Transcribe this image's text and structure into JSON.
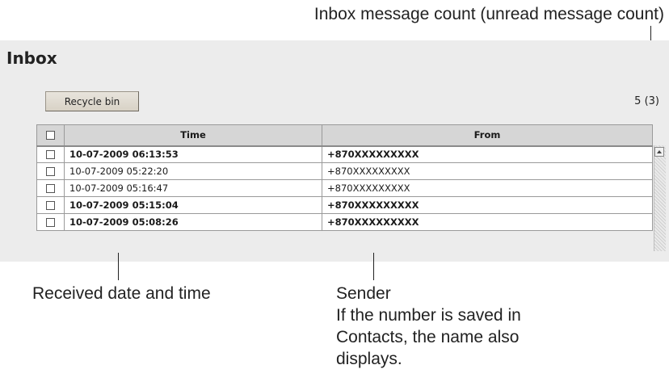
{
  "callouts": {
    "count_label": "Inbox message count (unread message count)",
    "received_label": "Received date and time",
    "sender_lines": [
      "Sender",
      "If the number is saved in",
      "Contacts, the name also",
      "displays."
    ]
  },
  "inbox": {
    "title": "Inbox",
    "recycle_bin_label": "Recycle bin",
    "count": "5 (3)",
    "columns": {
      "time": "Time",
      "from": "From"
    },
    "rows": [
      {
        "time": "10-07-2009 06:13:53",
        "from": "+870XXXXXXXXX",
        "unread": true
      },
      {
        "time": "10-07-2009 05:22:20",
        "from": "+870XXXXXXXXX",
        "unread": false
      },
      {
        "time": "10-07-2009 05:16:47",
        "from": "+870XXXXXXXXX",
        "unread": false
      },
      {
        "time": "10-07-2009 05:15:04",
        "from": "+870XXXXXXXXX",
        "unread": true
      },
      {
        "time": "10-07-2009 05:08:26",
        "from": "+870XXXXXXXXX",
        "unread": true
      }
    ]
  },
  "icons": {
    "checkbox": "checkbox-icon",
    "scroll_up": "scroll-up-arrow-icon"
  }
}
